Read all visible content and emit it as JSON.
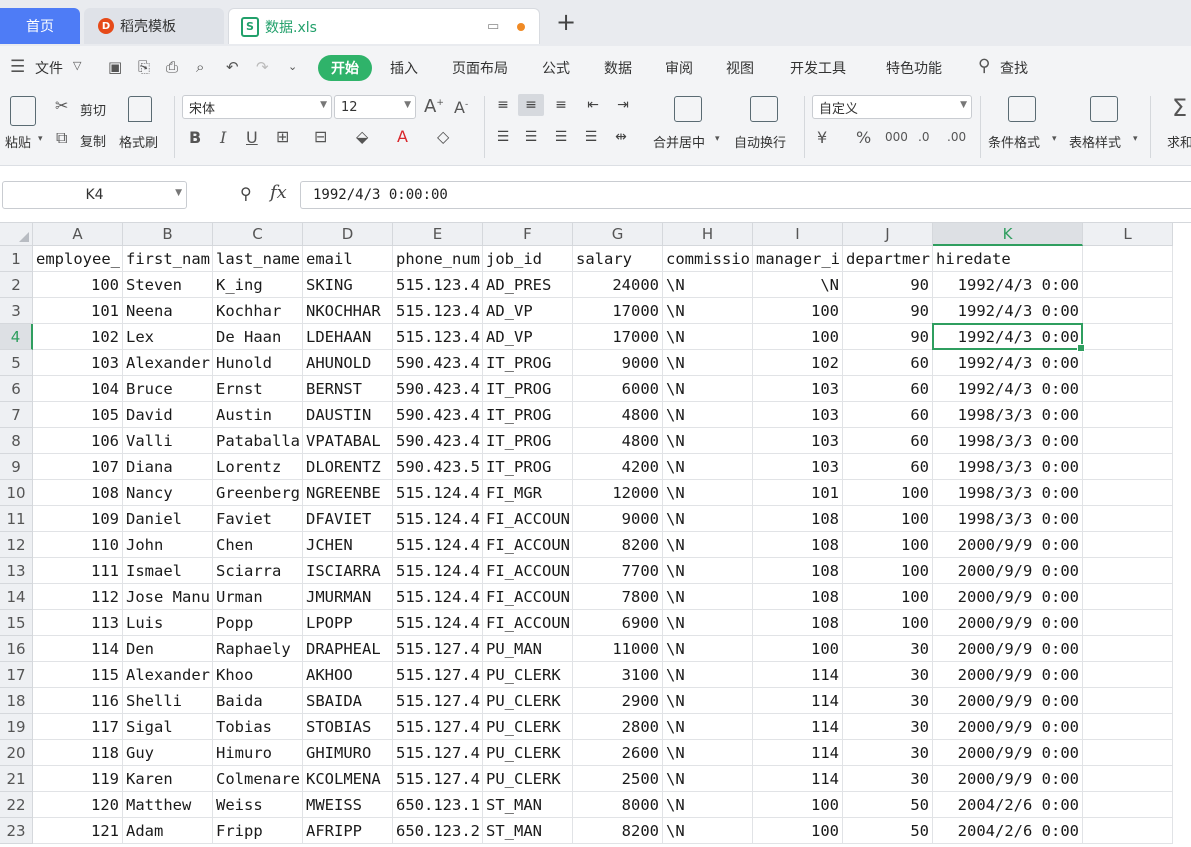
{
  "tabs": [
    {
      "label": "首页"
    },
    {
      "label": "稻壳模板",
      "logo": "D"
    },
    {
      "label": "数据.xls",
      "logo": "S"
    }
  ],
  "menu": {
    "hamburger_label": "文件",
    "items": [
      "插入",
      "页面布局",
      "公式",
      "数据",
      "审阅",
      "视图",
      "开发工具",
      "特色功能"
    ],
    "active": "开始",
    "search": "查找"
  },
  "ribbon": {
    "paste": "粘贴",
    "cut": "剪切",
    "copy": "复制",
    "format_painter": "格式刷",
    "font_name": "宋体",
    "font_size": "12",
    "merge_center": "合并居中",
    "wrap_text": "自动换行",
    "number_format": "自定义",
    "conditional_format": "条件格式",
    "table_style": "表格样式",
    "sum": "求和"
  },
  "formula_bar": {
    "name_box": "K4",
    "fx": "fx",
    "value": "1992/4/3 0:00:00"
  },
  "sheet": {
    "columns": [
      "A",
      "B",
      "C",
      "D",
      "E",
      "F",
      "G",
      "H",
      "I",
      "J",
      "K",
      "L"
    ],
    "selected_column": "K",
    "selected_row": "4",
    "rows": [
      {
        "n": "1",
        "cells": [
          "employee_",
          "first_nam",
          "last_name",
          "email",
          "phone_num",
          "job_id",
          "salary",
          "commissio",
          "manager_i",
          "departmer",
          "hiredate"
        ]
      },
      {
        "n": "2",
        "cells": [
          "100",
          "Steven",
          "K_ing",
          "SKING",
          "515.123.4",
          "AD_PRES",
          "24000",
          "\\N",
          "\\N",
          "90",
          "1992/4/3 0:00"
        ]
      },
      {
        "n": "3",
        "cells": [
          "101",
          "Neena",
          "Kochhar",
          "NKOCHHAR",
          "515.123.4",
          "AD_VP",
          "17000",
          "\\N",
          "100",
          "90",
          "1992/4/3 0:00"
        ]
      },
      {
        "n": "4",
        "cells": [
          "102",
          "Lex",
          "De Haan",
          "LDEHAAN",
          "515.123.4",
          "AD_VP",
          "17000",
          "\\N",
          "100",
          "90",
          "1992/4/3 0:00"
        ]
      },
      {
        "n": "5",
        "cells": [
          "103",
          "Alexander",
          "Hunold",
          "AHUNOLD",
          "590.423.4",
          "IT_PROG",
          "9000",
          "\\N",
          "102",
          "60",
          "1992/4/3 0:00"
        ]
      },
      {
        "n": "6",
        "cells": [
          "104",
          "Bruce",
          "Ernst",
          "BERNST",
          "590.423.4",
          "IT_PROG",
          "6000",
          "\\N",
          "103",
          "60",
          "1992/4/3 0:00"
        ]
      },
      {
        "n": "7",
        "cells": [
          "105",
          "David",
          "Austin",
          "DAUSTIN",
          "590.423.4",
          "IT_PROG",
          "4800",
          "\\N",
          "103",
          "60",
          "1998/3/3 0:00"
        ]
      },
      {
        "n": "8",
        "cells": [
          "106",
          "Valli",
          "Pataballa",
          "VPATABAL",
          "590.423.4",
          "IT_PROG",
          "4800",
          "\\N",
          "103",
          "60",
          "1998/3/3 0:00"
        ]
      },
      {
        "n": "9",
        "cells": [
          "107",
          "Diana",
          "Lorentz",
          "DLORENTZ",
          "590.423.5",
          "IT_PROG",
          "4200",
          "\\N",
          "103",
          "60",
          "1998/3/3 0:00"
        ]
      },
      {
        "n": "10",
        "cells": [
          "108",
          "Nancy",
          "Greenberg",
          "NGREENBE",
          "515.124.4",
          "FI_MGR",
          "12000",
          "\\N",
          "101",
          "100",
          "1998/3/3 0:00"
        ]
      },
      {
        "n": "11",
        "cells": [
          "109",
          "Daniel",
          "Faviet",
          "DFAVIET",
          "515.124.4",
          "FI_ACCOUN",
          "9000",
          "\\N",
          "108",
          "100",
          "1998/3/3 0:00"
        ]
      },
      {
        "n": "12",
        "cells": [
          "110",
          "John",
          "Chen",
          "JCHEN",
          "515.124.4",
          "FI_ACCOUN",
          "8200",
          "\\N",
          "108",
          "100",
          "2000/9/9 0:00"
        ]
      },
      {
        "n": "13",
        "cells": [
          "111",
          "Ismael",
          "Sciarra",
          "ISCIARRA",
          "515.124.4",
          "FI_ACCOUN",
          "7700",
          "\\N",
          "108",
          "100",
          "2000/9/9 0:00"
        ]
      },
      {
        "n": "14",
        "cells": [
          "112",
          "Jose Manu",
          "Urman",
          "JMURMAN",
          "515.124.4",
          "FI_ACCOUN",
          "7800",
          "\\N",
          "108",
          "100",
          "2000/9/9 0:00"
        ]
      },
      {
        "n": "15",
        "cells": [
          "113",
          "Luis",
          "Popp",
          "LPOPP",
          "515.124.4",
          "FI_ACCOUN",
          "6900",
          "\\N",
          "108",
          "100",
          "2000/9/9 0:00"
        ]
      },
      {
        "n": "16",
        "cells": [
          "114",
          "Den",
          "Raphaely",
          "DRAPHEAL",
          "515.127.4",
          "PU_MAN",
          "11000",
          "\\N",
          "100",
          "30",
          "2000/9/9 0:00"
        ]
      },
      {
        "n": "17",
        "cells": [
          "115",
          "Alexander",
          "Khoo",
          "AKHOO",
          "515.127.4",
          "PU_CLERK",
          "3100",
          "\\N",
          "114",
          "30",
          "2000/9/9 0:00"
        ]
      },
      {
        "n": "18",
        "cells": [
          "116",
          "Shelli",
          "Baida",
          "SBAIDA",
          "515.127.4",
          "PU_CLERK",
          "2900",
          "\\N",
          "114",
          "30",
          "2000/9/9 0:00"
        ]
      },
      {
        "n": "19",
        "cells": [
          "117",
          "Sigal",
          "Tobias",
          "STOBIAS",
          "515.127.4",
          "PU_CLERK",
          "2800",
          "\\N",
          "114",
          "30",
          "2000/9/9 0:00"
        ]
      },
      {
        "n": "20",
        "cells": [
          "118",
          "Guy",
          "Himuro",
          "GHIMURO",
          "515.127.4",
          "PU_CLERK",
          "2600",
          "\\N",
          "114",
          "30",
          "2000/9/9 0:00"
        ]
      },
      {
        "n": "21",
        "cells": [
          "119",
          "Karen",
          "Colmenare",
          "KCOLMENA",
          "515.127.4",
          "PU_CLERK",
          "2500",
          "\\N",
          "114",
          "30",
          "2000/9/9 0:00"
        ]
      },
      {
        "n": "22",
        "cells": [
          "120",
          "Matthew",
          "Weiss",
          "MWEISS",
          "650.123.1",
          "ST_MAN",
          "8000",
          "\\N",
          "100",
          "50",
          "2004/2/6 0:00"
        ]
      },
      {
        "n": "23",
        "cells": [
          "121",
          "Adam",
          "Fripp",
          "AFRIPP",
          "650.123.2",
          "ST_MAN",
          "8200",
          "\\N",
          "100",
          "50",
          "2004/2/6 0:00"
        ]
      }
    ]
  },
  "colors": {
    "accent_green": "#2fb36a",
    "selection_green": "#2f9e5f",
    "home_tab_blue": "#4e7cf6"
  }
}
